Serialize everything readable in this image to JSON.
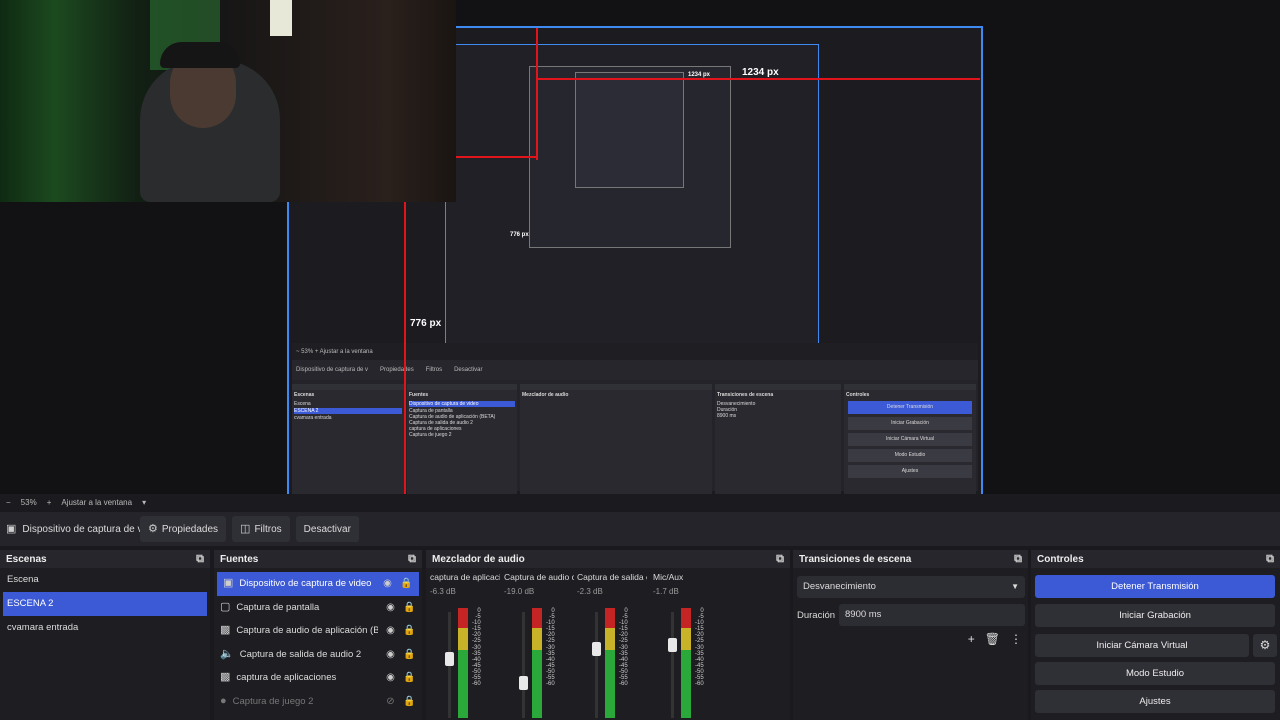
{
  "preview": {
    "label_width": "1234 px",
    "label_height": "776 px",
    "inner_label_width": "1234 px",
    "inner_label_height": "776 px",
    "nested_zoom": "~ 53% + Ajustar a la ventana",
    "nested_ctx": [
      "Dispositivo de captura de v",
      "Propiedades",
      "Filtros",
      "Desactivar"
    ],
    "nested_scenes_title": "Escenas",
    "nested_sources_title": "Fuentes",
    "nested_mixer_title": "Mezclador de audio",
    "nested_trans_title": "Transiciones de escena",
    "nested_controls_title": "Controles",
    "nested_scenes": [
      "Escena",
      "ESCENA 2",
      "cvamara entrada"
    ],
    "nested_sources": [
      "Dispositivo de captura de video",
      "Captura de pantalla",
      "Captura de audio de aplicación (BETA)",
      "Captura de salida de audio 2",
      "captura de aplicaciones",
      "Captura de juego 2"
    ],
    "nested_trans": [
      "Desvanecimiento",
      "Duración",
      "8900 ms"
    ],
    "nested_controls": [
      "Detener Transmisión",
      "Iniciar Grabación",
      "Iniciar Cámara Virtual",
      "Modo Estudio",
      "Ajustes"
    ]
  },
  "zoombar": {
    "minus": "−",
    "zoom": "53%",
    "plus": "+",
    "fit": "Ajustar a la ventana",
    "caret": "▾"
  },
  "ctx": {
    "source": "Dispositivo de captura de v",
    "properties": "Propiedades",
    "filters": "Filtros",
    "deactivate": "Desactivar"
  },
  "scenes": {
    "title": "Escenas",
    "items": [
      {
        "label": "Escena"
      },
      {
        "label": "ESCENA 2"
      },
      {
        "label": "cvamara entrada"
      }
    ]
  },
  "sources": {
    "title": "Fuentes",
    "items": [
      {
        "label": "Dispositivo de captura de video"
      },
      {
        "label": "Captura de pantalla"
      },
      {
        "label": "Captura de audio de aplicación (BETA)"
      },
      {
        "label": "Captura de salida de audio 2"
      },
      {
        "label": "captura de aplicaciones"
      },
      {
        "label": "Captura de juego 2"
      }
    ]
  },
  "mixer": {
    "title": "Mezclador de audio",
    "scale": [
      "0",
      "-5",
      "-10",
      "-15",
      "-20",
      "-25",
      "-30",
      "-35",
      "-40",
      "-45",
      "-50",
      "-55",
      "-60"
    ],
    "channels": [
      {
        "name": "captura de aplicaci",
        "db": "-6.3 dB"
      },
      {
        "name": "Captura de audio c",
        "db": "-19.0 dB"
      },
      {
        "name": "Captura de salida c",
        "db": "-2.3 dB"
      },
      {
        "name": "Mic/Aux",
        "db": "-1.7 dB"
      }
    ]
  },
  "transitions": {
    "title": "Transiciones de escena",
    "selected": "Desvanecimiento",
    "duration_label": "Duración",
    "duration_value": "8900 ms"
  },
  "controls": {
    "title": "Controles",
    "stop_stream": "Detener Transmisión",
    "start_record": "Iniciar Grabación",
    "start_vcam": "Iniciar Cámara Virtual",
    "studio_mode": "Modo Estudio",
    "settings": "Ajustes"
  },
  "colors": {
    "accent": "#3c5ad6",
    "selection_outline": "#3e8af0",
    "guide_red": "#e0141a"
  }
}
